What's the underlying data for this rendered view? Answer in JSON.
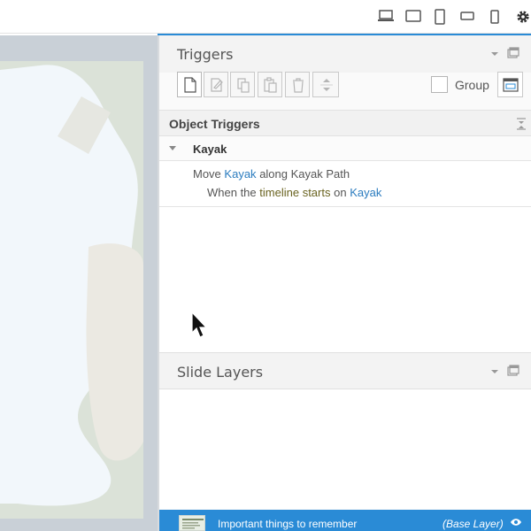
{
  "device_bar": {
    "icons": [
      "laptop-icon",
      "tablet-landscape-icon",
      "tablet-portrait-icon",
      "phone-landscape-icon",
      "phone-portrait-icon",
      "gear-icon"
    ]
  },
  "triggers_panel": {
    "title": "Triggers",
    "toolbar_buttons": [
      "new-trigger-icon",
      "edit-trigger-icon",
      "copy-icon",
      "paste-icon",
      "delete-icon",
      "move-up-down-icon"
    ],
    "group_label": "Group",
    "group_checked": false
  },
  "object_triggers": {
    "title": "Object Triggers",
    "object_name": "Kayak",
    "trigger": {
      "action": "Move",
      "target": "Kayak",
      "mid": "along",
      "path": "Kayak Path",
      "when": "When the",
      "event": "timeline starts",
      "on": "on",
      "source": "Kayak"
    }
  },
  "slide_layers": {
    "title": "Slide Layers",
    "base": {
      "title": "Important things to remember",
      "layer": "(Base Layer)"
    }
  },
  "colors": {
    "accent": "#2a8bd6",
    "link": "#2b7cbf",
    "event": "#6a6320"
  }
}
